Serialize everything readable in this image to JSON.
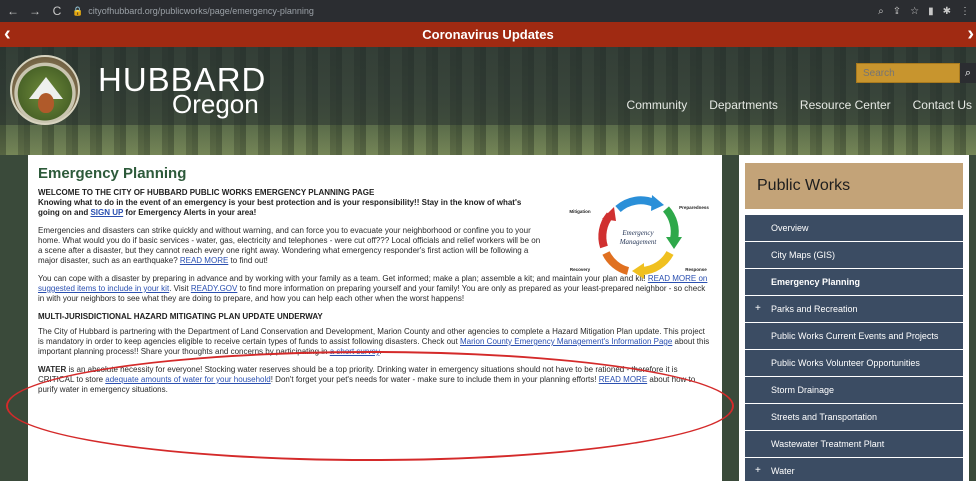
{
  "browser": {
    "back": "←",
    "forward": "→",
    "reload": "C",
    "url": "cityofhubbard.org/publicworks/page/emergency-planning",
    "icons": [
      "search-icon",
      "share-icon",
      "star-icon",
      "reader-icon",
      "extensions-icon",
      "menu-icon"
    ]
  },
  "alert": {
    "label": "Coronavirus Updates",
    "prev": "‹",
    "next": "›"
  },
  "header": {
    "brand_title": "HUBBARD",
    "brand_subtitle": "Oregon",
    "search_placeholder": "Search",
    "nav": [
      "Community",
      "Departments",
      "Resource Center",
      "Contact Us"
    ]
  },
  "content": {
    "title": "Emergency Planning",
    "welcome_heading": "WELCOME TO THE CITY OF HUBBARD PUBLIC WORKS EMERGENCY PLANNING PAGE",
    "welcome_text_a": "Knowing what to do in the event of an emergency is your best protection and is your responsibility!! Stay in the know of what's going on and ",
    "sign_up_link": "SIGN UP",
    "welcome_text_b": " for Emergency Alerts in your area!",
    "para1_text": "Emergencies and disasters can strike quickly and without warning, and can force you to evacuate your neighborhood or confine you to your home. What would you do if basic services - water, gas, electricity and telephones - were cut off??? Local officials and relief workers will be on a scene after a disaster, but they cannot reach every one right away. Wondering what emergency responder's first action will be following a major disaster, such as an earthquake? ",
    "para1_link": "READ MORE",
    "para1_tail": " to find out!",
    "para2_a": "You can cope with a disaster by preparing in advance and by working with your family as a team. Get informed; make a plan; assemble a kit; and maintain your plan and kit! ",
    "para2_link1": "READ MORE on suggested items to include in your kit",
    "para2_b": ". Visit ",
    "para2_link2": "READY.GOV",
    "para2_c": " to find more information on preparing yourself and your family! You are only as prepared as your least-prepared neighbor - so check in with your neighbors to see what they are doing to prepare, and how you can help each other when the worst happens!",
    "section_heading": "MULTI-JURISDICTIONAL HAZARD MITIGATING PLAN UPDATE UNDERWAY",
    "para3_a": "The City of Hubbard is partnering with the Department of Land Conservation and Development, Marion County and other agencies to complete a Hazard Mitigation Plan update. This project is mandatory in order to keep agencies eligible to receive certain types of funds to assist following disasters. Check out ",
    "para3_link1": "Marion County Emergency Management's Information Page",
    "para3_b": " about this important planning process!! Share your thoughts and concerns by participating in ",
    "para3_link2": "a short survey",
    "para3_c": ".",
    "para4_bold": "WATER",
    "para4_a": " is an absolute necessity for everyone! Stocking water reserves should be a top priority. Drinking water in emergency situations should not have to be rationed - therefore it is CRITICAL to store ",
    "para4_link1": "adequate amounts of water for your household",
    "para4_b": "! Don't forget your pet's needs for water - make sure to include them in your planning efforts! ",
    "para4_link2": "READ MORE",
    "para4_c": " about how to purify water in emergency situations."
  },
  "diagram": {
    "center_line1": "Emergency",
    "center_line2": "Management",
    "labels": [
      "Mitigation",
      "Preparedness",
      "Response",
      "Recovery"
    ],
    "colors": [
      "#2a8fd8",
      "#2ea84a",
      "#f0c020",
      "#e07020",
      "#d03030"
    ]
  },
  "sidebar": {
    "title": "Public Works",
    "items": [
      {
        "label": "Overview",
        "expandable": false
      },
      {
        "label": "City Maps (GIS)",
        "expandable": false
      },
      {
        "label": "Emergency Planning",
        "expandable": false
      },
      {
        "label": "Parks and Recreation",
        "expandable": true
      },
      {
        "label": "Public Works Current Events and Projects",
        "expandable": false
      },
      {
        "label": "Public Works Volunteer Opportunities",
        "expandable": false
      },
      {
        "label": "Storm Drainage",
        "expandable": false
      },
      {
        "label": "Streets and Transportation",
        "expandable": false
      },
      {
        "label": "Wastewater Treatment Plant",
        "expandable": false
      },
      {
        "label": "Water",
        "expandable": true
      }
    ],
    "plus_symbol": "+"
  }
}
